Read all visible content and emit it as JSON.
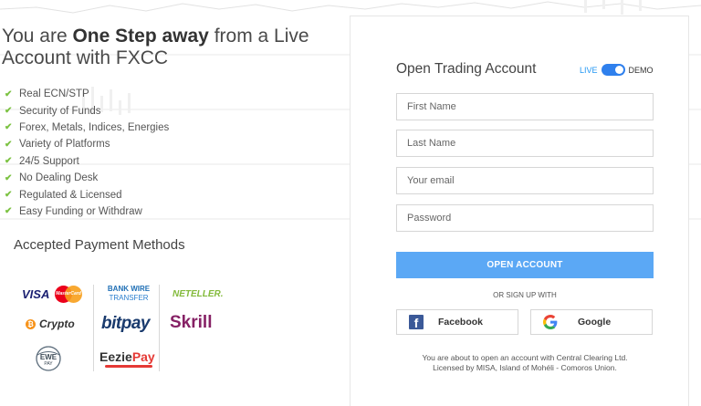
{
  "headline": {
    "prefix": "You are ",
    "bold": "One Step away",
    "suffix": " from a Live Account with FXCC"
  },
  "features": [
    "Real ECN/STP",
    "Security of Funds",
    "Forex, Metals, Indices, Energies",
    "Variety of Platforms",
    "24/5 Support",
    "No Dealing Desk",
    "Regulated & Licensed",
    "Easy Funding or Withdraw"
  ],
  "payment_methods": {
    "title": "Accepted Payment Methods",
    "visa": "VISA",
    "mastercard": "MasterCard",
    "bank_wire_1": "BANK WIRE",
    "bank_wire_2": "TRANSFER",
    "neteller": "NETELLER.",
    "crypto": "Crypto",
    "bitpay": "bitpay",
    "skrill": "Skrill",
    "ewe": "EWE",
    "ewe_sub": "PAY",
    "eeziepay_1": "Eezie",
    "eeziepay_2": "Pay"
  },
  "form": {
    "title": "Open Trading Account",
    "toggle_live": "LIVE",
    "toggle_demo": "DEMO",
    "first_name_placeholder": "First Name",
    "last_name_placeholder": "Last Name",
    "email_placeholder": "Your email",
    "password_placeholder": "Password",
    "open_button": "OPEN ACCOUNT",
    "or_text": "OR SIGN UP WITH",
    "facebook_label": "Facebook",
    "google_label": "Google",
    "legal_line1": "You are about to open an account with Central Clearing Ltd.",
    "legal_line2": "Licensed by MISA, Island of Mohéli - Comoros Union."
  },
  "colors": {
    "primary_button": "#5ba8f5",
    "toggle": "#2f80ed",
    "check": "#7cc242",
    "skrill": "#862165",
    "neteller": "#83ba3b"
  }
}
